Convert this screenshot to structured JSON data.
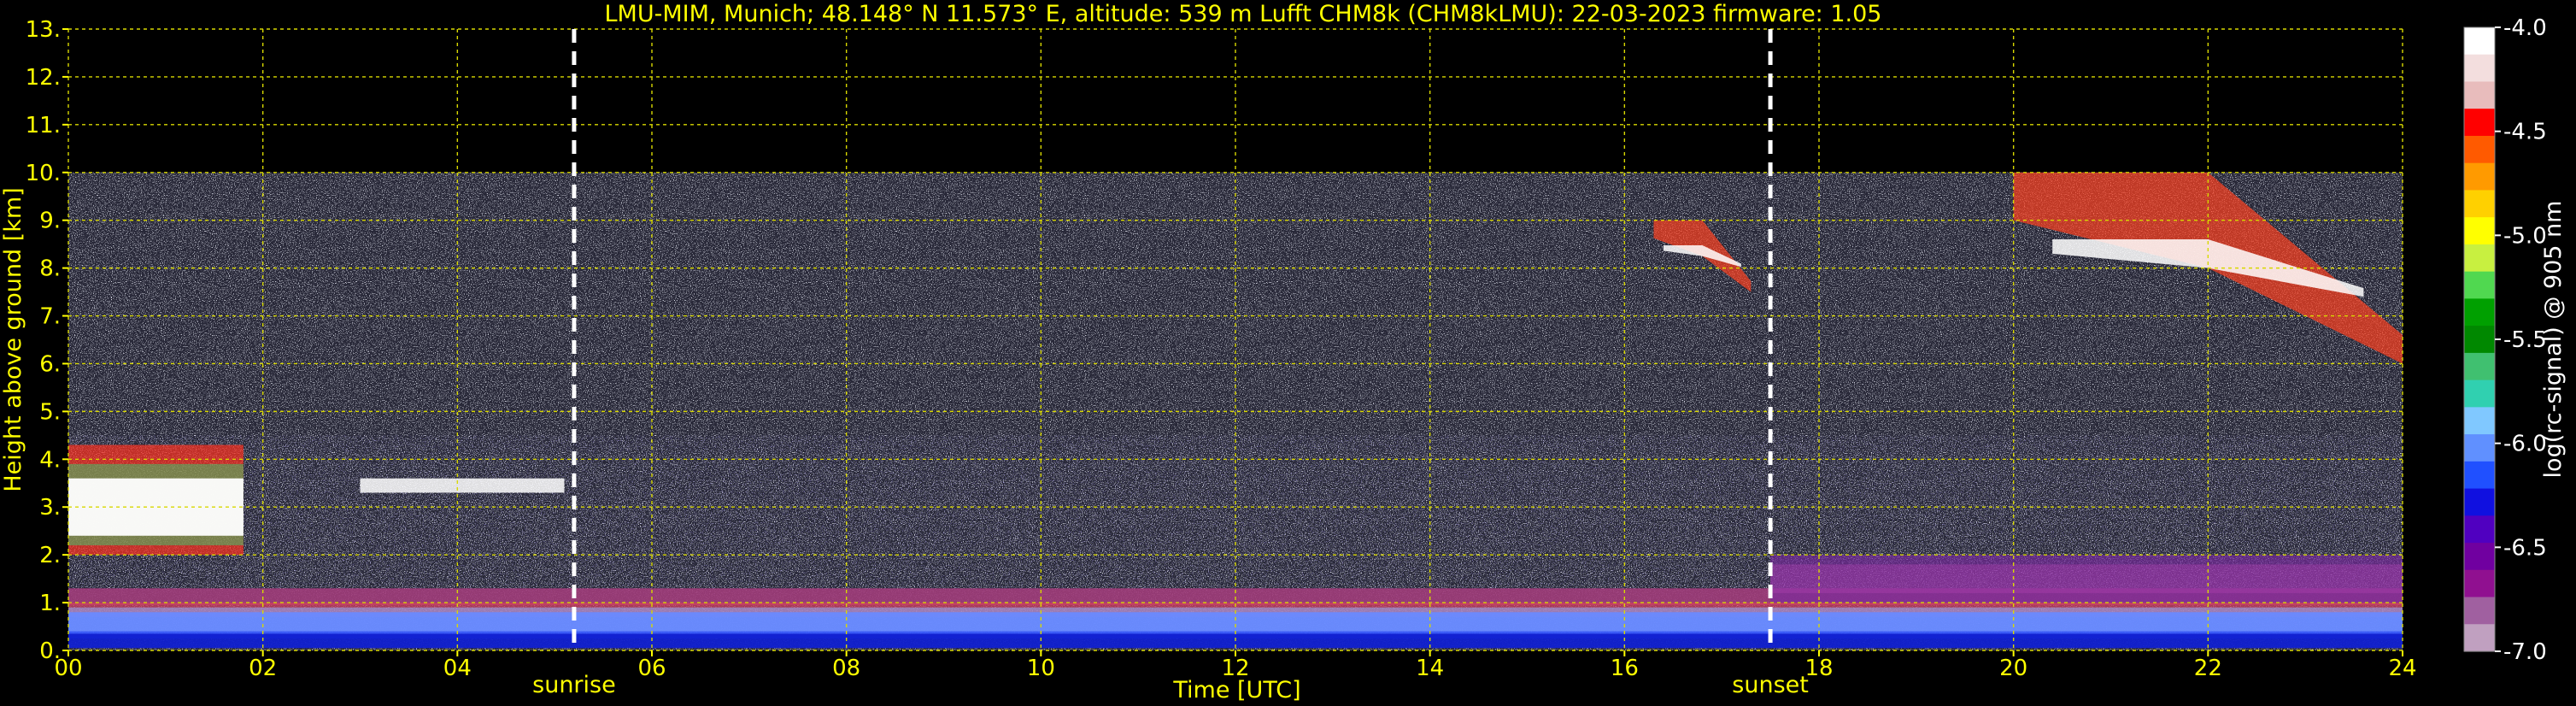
{
  "chart_data": {
    "type": "heatmap",
    "title": "LMU-MIM, Munich; 48.148° N 11.573° E, altitude: 539 m    Lufft CHM8k (CHM8kLMU): 22-03-2023    firmware: 1.05",
    "xlabel": "Time [UTC]",
    "ylabel": "Height above ground [km]",
    "xlim": [
      0,
      24
    ],
    "ylim": [
      0,
      13
    ],
    "x_ticks": [
      "00",
      "02",
      "04",
      "06",
      "08",
      "10",
      "12",
      "14",
      "16",
      "18",
      "20",
      "22",
      "24"
    ],
    "y_ticks": [
      "0.",
      "1.",
      "2.",
      "3.",
      "4.",
      "5.",
      "6.",
      "7.",
      "8.",
      "9.",
      "10.",
      "11.",
      "12.",
      "13."
    ],
    "grid": true,
    "data_top_height_km": 10,
    "events": [
      {
        "label": "sunrise",
        "time_utc": 5.2
      },
      {
        "label": "sunset",
        "time_utc": 17.5
      }
    ],
    "colorbar": {
      "label": "log(rc-signal) @ 905 nm",
      "range": [
        -7.0,
        -4.0
      ],
      "ticks": [
        "-4.0",
        "-4.5",
        "-5.0",
        "-5.5",
        "-6.0",
        "-6.5",
        "-7.0"
      ],
      "colors": [
        "#ffffff",
        "#f3dede",
        "#e8bcbc",
        "#ff0000",
        "#ff5a00",
        "#ff9a00",
        "#ffd000",
        "#ffff00",
        "#c8f040",
        "#50d850",
        "#00a000",
        "#008800",
        "#40c070",
        "#30d0b0",
        "#80c8ff",
        "#6090ff",
        "#2050ff",
        "#1010e0",
        "#5000c0",
        "#7000a0",
        "#901090",
        "#a060a0",
        "#c0a0c0"
      ]
    },
    "features": [
      {
        "type": "boundary_layer",
        "time_range": [
          0,
          24
        ],
        "height_range_km": [
          0,
          1.3
        ]
      },
      {
        "type": "residual_layer",
        "time_range": [
          17.5,
          24
        ],
        "height_range_km": [
          1.0,
          2.0
        ]
      },
      {
        "type": "low_cloud",
        "time_range": [
          0,
          1.8
        ],
        "height_range_km": [
          2.0,
          4.3
        ]
      },
      {
        "type": "cloud_fragments",
        "time_range": [
          3.0,
          5.1
        ],
        "height_range_km": [
          3.3,
          3.6
        ]
      },
      {
        "type": "cirrus",
        "time_range": [
          16.3,
          17.3
        ],
        "height_range_km": [
          7.5,
          9.0
        ]
      },
      {
        "type": "cirrus",
        "time_range": [
          20.0,
          24
        ],
        "height_range_km": [
          6.0,
          10.0
        ]
      }
    ]
  }
}
